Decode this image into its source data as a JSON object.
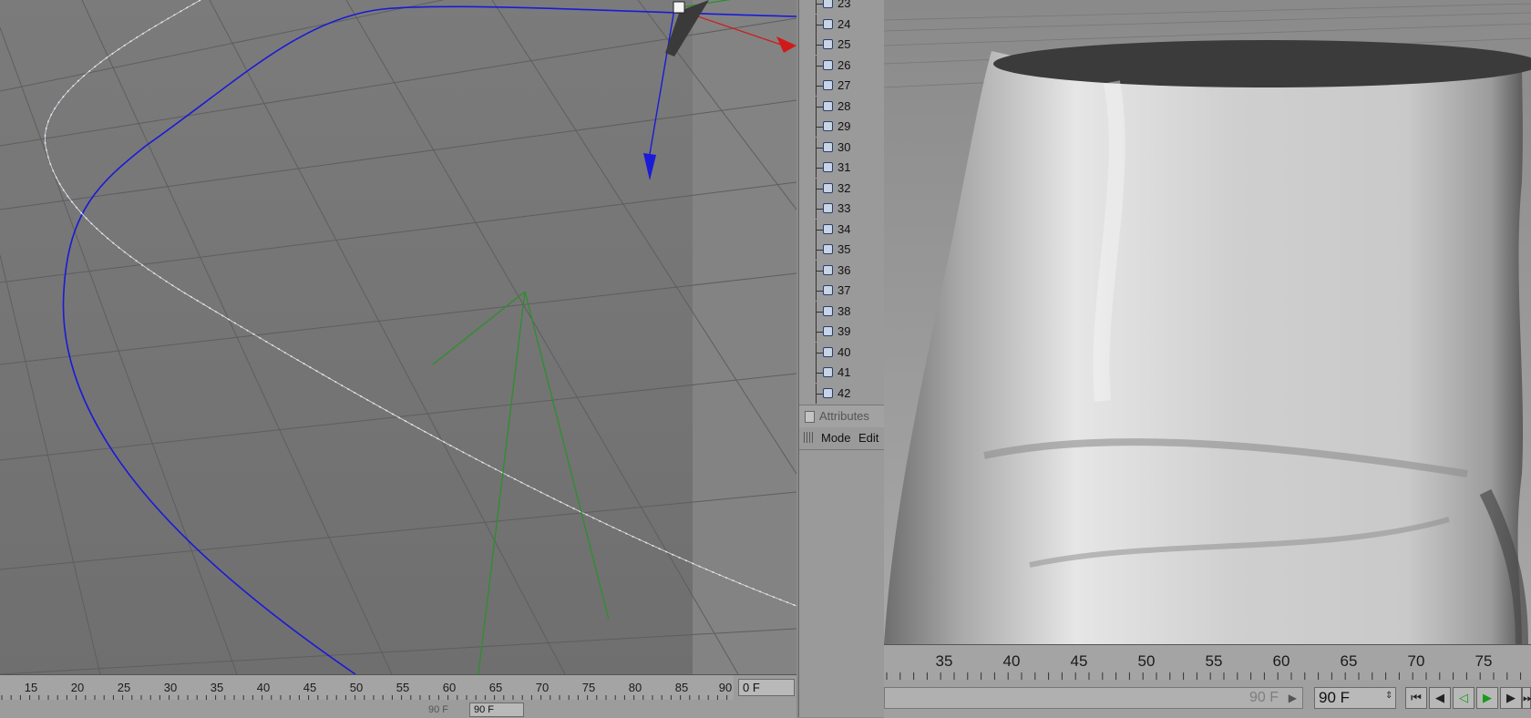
{
  "left_viewport": {
    "timeline": {
      "ticks": [
        "15",
        "20",
        "25",
        "30",
        "35",
        "40",
        "45",
        "50",
        "55",
        "60",
        "65",
        "70",
        "75",
        "80",
        "85",
        "90"
      ],
      "current_frame_field": "0 F",
      "end_frame_label": "90 F",
      "end_frame_field": "90 F"
    }
  },
  "object_manager": {
    "items": [
      "23",
      "24",
      "25",
      "26",
      "27",
      "28",
      "29",
      "30",
      "31",
      "32",
      "33",
      "34",
      "35",
      "36",
      "37",
      "38",
      "39",
      "40",
      "41",
      "42"
    ]
  },
  "attributes": {
    "title": "Attributes",
    "menu": [
      "Mode",
      "Edit"
    ]
  },
  "right_viewport": {
    "timeline": {
      "ticks": [
        "35",
        "40",
        "45",
        "50",
        "55",
        "60",
        "65",
        "70",
        "75"
      ],
      "end_frame_label": "90 F",
      "end_frame_field": "90 F"
    }
  },
  "icons": {
    "object_icon": "null-object-icon",
    "transport": [
      "go-to-start-icon",
      "step-back-icon",
      "play-reverse-icon",
      "play-forward-icon",
      "step-forward-icon",
      "go-to-end-icon"
    ]
  },
  "colors": {
    "spline_blue": "#1a1ad8",
    "spline_white": "#e8eef6",
    "axis_green": "#2c8f2c",
    "axis_red": "#d01a1a"
  }
}
